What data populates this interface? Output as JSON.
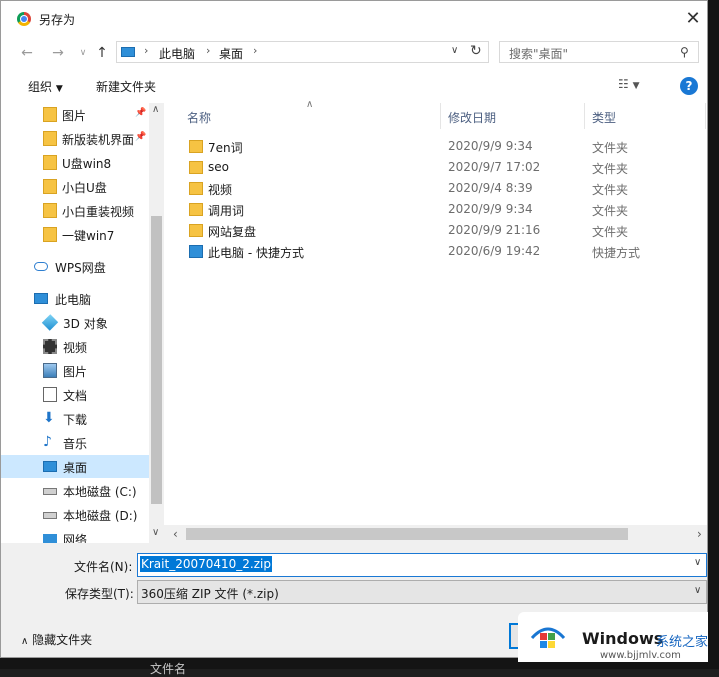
{
  "window": {
    "title": "另存为"
  },
  "address": {
    "crumbs": [
      "此电脑",
      "桌面"
    ]
  },
  "search": {
    "placeholder": "搜索\"桌面\""
  },
  "toolbar": {
    "organize": "组织",
    "new_folder": "新建文件夹"
  },
  "sidebar": {
    "items": [
      {
        "label": "图片",
        "icon": "folder-icon",
        "pinned": true
      },
      {
        "label": "新版装机界面",
        "icon": "folder-icon",
        "pinned": true
      },
      {
        "label": "U盘win8",
        "icon": "folder-icon"
      },
      {
        "label": "小白U盘",
        "icon": "folder-icon"
      },
      {
        "label": "小白重装视频",
        "icon": "folder-icon"
      },
      {
        "label": "一键win7",
        "icon": "folder-icon"
      },
      {
        "label": "WPS网盘",
        "icon": "cloud-icon"
      },
      {
        "label": "此电脑",
        "icon": "computer-icon"
      },
      {
        "label": "3D 对象",
        "icon": "cube-icon"
      },
      {
        "label": "视频",
        "icon": "video-icon"
      },
      {
        "label": "图片",
        "icon": "picture-icon"
      },
      {
        "label": "文档",
        "icon": "document-icon"
      },
      {
        "label": "下载",
        "icon": "download-icon"
      },
      {
        "label": "音乐",
        "icon": "music-icon"
      },
      {
        "label": "桌面",
        "icon": "desktop-icon",
        "selected": true
      },
      {
        "label": "本地磁盘 (C:)",
        "icon": "drive-icon"
      },
      {
        "label": "本地磁盘 (D:)",
        "icon": "drive-icon"
      },
      {
        "label": "网络",
        "icon": "network-icon"
      }
    ]
  },
  "files": {
    "columns": {
      "name": "名称",
      "date": "修改日期",
      "type": "类型"
    },
    "rows": [
      {
        "name": "7en词",
        "date": "2020/9/9 9:34",
        "type": "文件夹",
        "icon": "folder-icon"
      },
      {
        "name": "seo",
        "date": "2020/9/7 17:02",
        "type": "文件夹",
        "icon": "folder-icon"
      },
      {
        "name": "视频",
        "date": "2020/9/4 8:39",
        "type": "文件夹",
        "icon": "folder-icon"
      },
      {
        "name": "调用词",
        "date": "2020/9/9 9:34",
        "type": "文件夹",
        "icon": "folder-icon"
      },
      {
        "name": "网站复盘",
        "date": "2020/9/9 21:16",
        "type": "文件夹",
        "icon": "folder-icon"
      },
      {
        "name": "此电脑 - 快捷方式",
        "date": "2020/6/9 19:42",
        "type": "快捷方式",
        "icon": "shortcut-icon"
      }
    ]
  },
  "form": {
    "filename_label": "文件名(N):",
    "filename_value": "Krait_20070410_2.zip",
    "filetype_label": "保存类型(T):",
    "filetype_value": "360压缩 ZIP 文件 (*.zip)",
    "hide_folders": "隐藏文件夹"
  },
  "background": {
    "peek_text": "文件名"
  },
  "watermark": {
    "brand": "Windows",
    "cn": "系统之家",
    "url": "www.bjjmlv.com"
  }
}
